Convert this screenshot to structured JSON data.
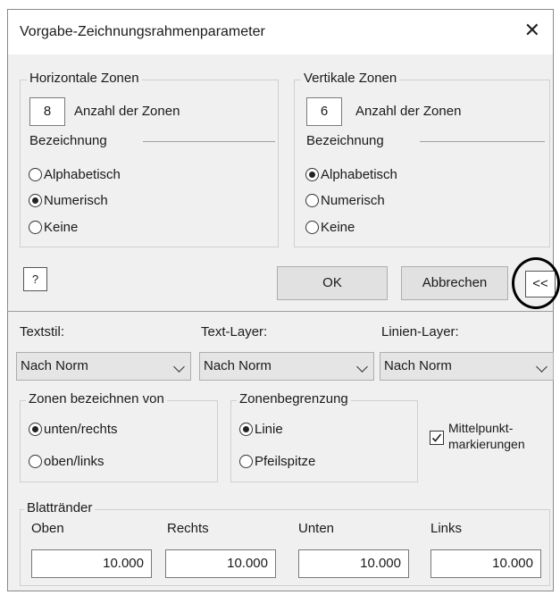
{
  "window": {
    "title": "Vorgabe-Zeichnungsrahmenparameter",
    "close_glyph": "✕"
  },
  "horizontal": {
    "legend": "Horizontale Zonen",
    "count": "8",
    "count_label": "Anzahl der Zonen",
    "naming_label": "Bezeichnung",
    "options": [
      "Alphabetisch",
      "Numerisch",
      "Keine"
    ],
    "selected": "Numerisch"
  },
  "vertical": {
    "legend": "Vertikale Zonen",
    "count": "6",
    "count_label": "Anzahl der Zonen",
    "naming_label": "Bezeichnung",
    "options": [
      "Alphabetisch",
      "Numerisch",
      "Keine"
    ],
    "selected": "Alphabetisch"
  },
  "buttons": {
    "help_glyph": "?",
    "ok": "OK",
    "cancel": "Abbrechen",
    "collapse": "<<"
  },
  "dropdowns": {
    "textstyle_label": "Textstil:",
    "textstyle_value": "Nach Norm",
    "textlayer_label": "Text-Layer:",
    "textlayer_value": "Nach Norm",
    "linelayer_label": "Linien-Layer:",
    "linelayer_value": "Nach Norm"
  },
  "zone_label_from": {
    "legend": "Zonen bezeichnen von",
    "options": [
      "unten/rechts",
      "oben/links"
    ],
    "selected": "unten/rechts"
  },
  "zone_border": {
    "legend": "Zonenbegrenzung",
    "options": [
      "Linie",
      "Pfeilspitze"
    ],
    "selected": "Linie"
  },
  "center_marks": {
    "label_line1": "Mittelpunkt-",
    "label_line2": "markierungen",
    "checked": true
  },
  "margins": {
    "legend": "Blattränder",
    "top_label": "Oben",
    "top_value": "10.000",
    "right_label": "Rechts",
    "right_value": "10.000",
    "bottom_label": "Unten",
    "bottom_value": "10.000",
    "left_label": "Links",
    "left_value": "10.000"
  }
}
